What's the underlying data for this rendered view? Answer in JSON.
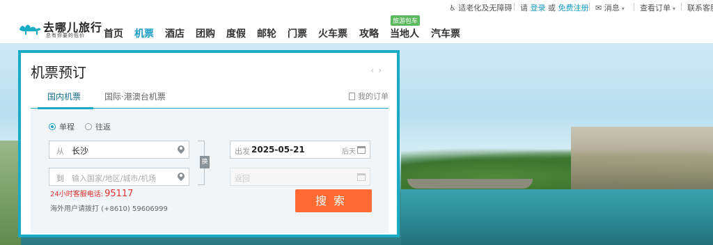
{
  "topbar": {
    "accessibility": "适老化及无障碍",
    "please": "请",
    "login": "登录",
    "or": "或",
    "register": "免费注册",
    "messages": "消息",
    "orders": "查看订单",
    "contact": "联系客服"
  },
  "logo": {
    "name": "去哪儿旅行",
    "slogan": "总有你要的低价"
  },
  "nav": {
    "items": [
      "首页",
      "机票",
      "酒店",
      "团购",
      "度假",
      "邮轮",
      "门票",
      "火车票",
      "攻略",
      "当地人",
      "汽车票"
    ],
    "active": "机票",
    "badge": "旅游包车"
  },
  "panel": {
    "title": "机票预订",
    "tabs": [
      "国内机票",
      "国际·港澳台机票"
    ],
    "my_order": "我的订单",
    "trip_types": [
      "单程",
      "往返"
    ],
    "selected_trip": "单程",
    "from_label": "从",
    "from_value": "长沙",
    "to_label": "到",
    "to_placeholder": "输入国家/地区/城市/机场",
    "depart_label": "出发",
    "depart_date": "2025-05-21",
    "depart_hint": "后天",
    "return_label": "返回",
    "swap_label": "换",
    "hotline_label": "24小时客服电话:",
    "hotline_number": "95117",
    "overseas": "海外用户请拨打 (+8610) 59606999",
    "search_button": "搜索"
  }
}
